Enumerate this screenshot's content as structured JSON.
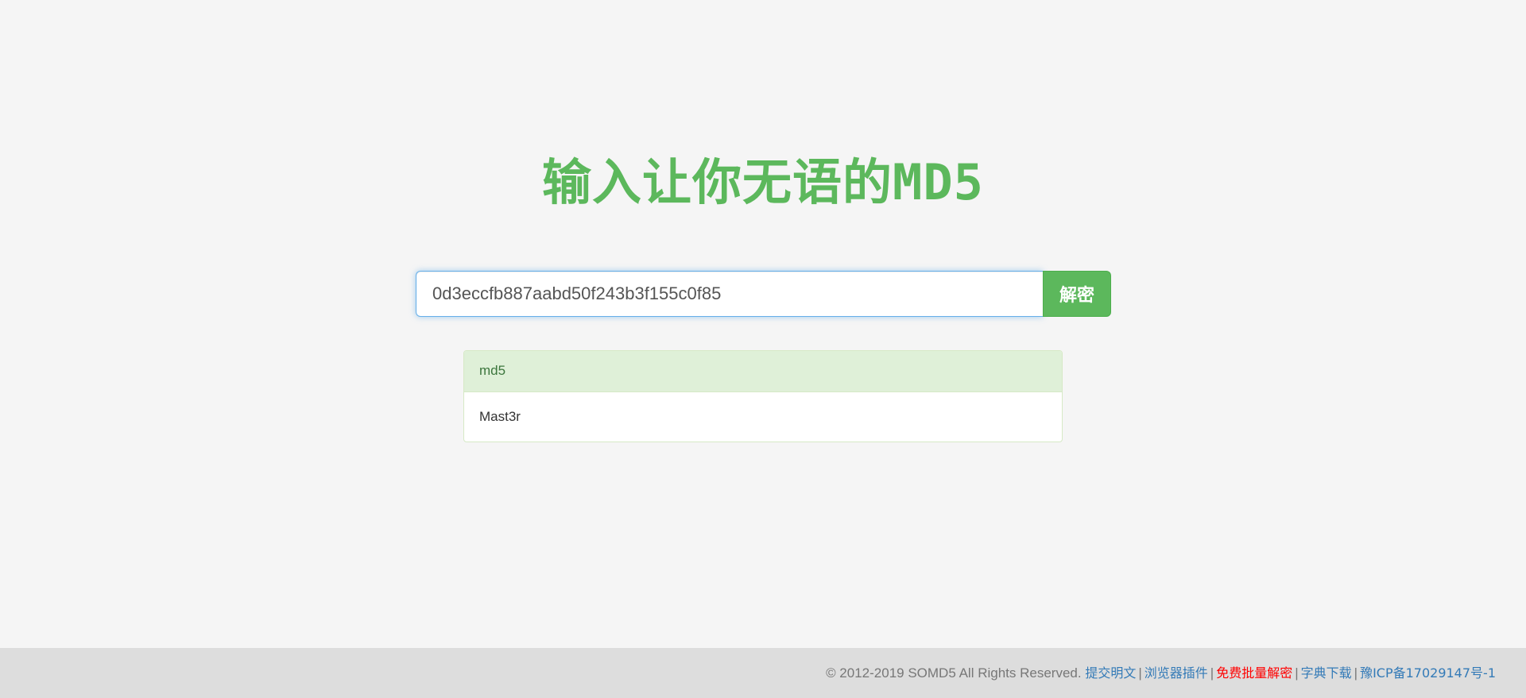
{
  "page": {
    "title": "输入让你无语的MD5"
  },
  "search": {
    "value": "0d3eccfb887aabd50f243b3f155c0f85",
    "button_label": "解密"
  },
  "result": {
    "heading": "md5",
    "value": "Mast3r"
  },
  "footer": {
    "copyright": "© 2012-2019 SOMD5 All Rights Reserved.",
    "links": [
      {
        "label": "提交明文"
      },
      {
        "label": "浏览器插件"
      },
      {
        "label": "免费批量解密"
      },
      {
        "label": "字典下载"
      },
      {
        "label": "豫ICP备17029147号-1"
      }
    ],
    "separator": "|"
  },
  "colors": {
    "brand_green": "#5cb85c",
    "link_blue": "#337ab7",
    "highlight_red": "#ff0000"
  }
}
